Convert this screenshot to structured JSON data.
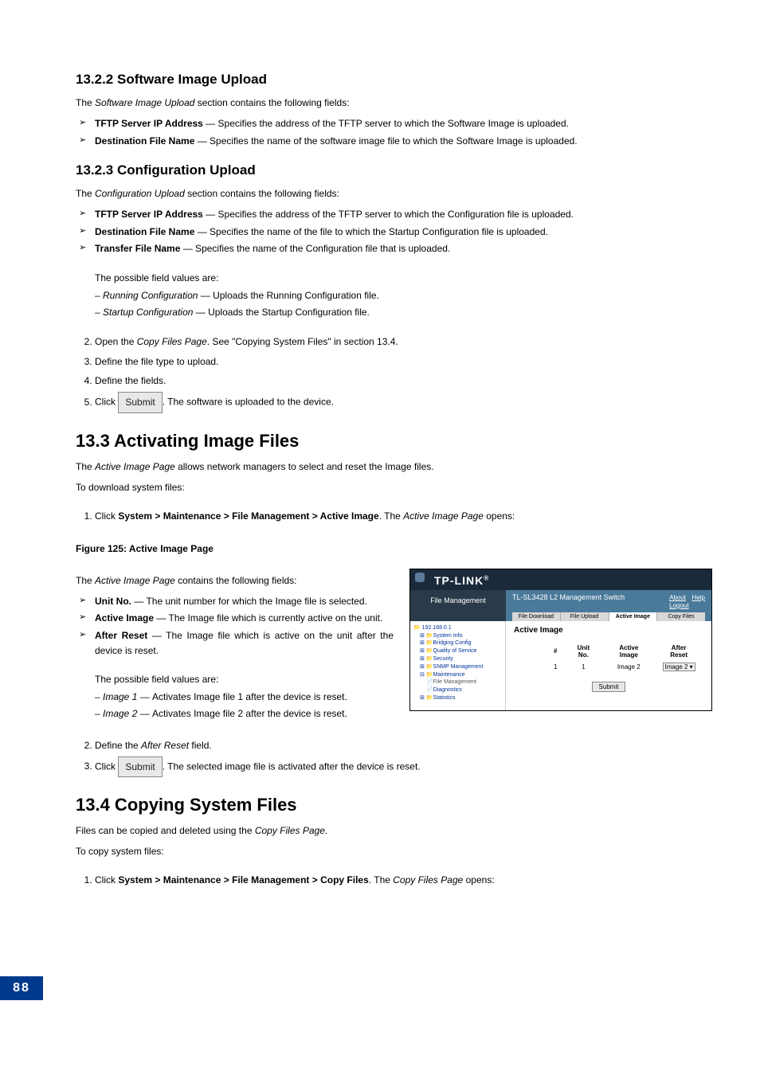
{
  "sec1": {
    "heading": "13.2.2  Software Image Upload",
    "intro_pre": "The ",
    "intro_em": "Software Image Upload",
    "intro_post": " section contains the following fields:",
    "b1_b": "TFTP Server IP Address",
    "b1_t": " — Specifies the address of the TFTP server to which the Software Image is uploaded.",
    "b2_b": "Destination File Name",
    "b2_t": " — Specifies the name of the software image file to which the Software Image is uploaded."
  },
  "sec2": {
    "heading": "13.2.3  Configuration Upload",
    "intro_pre": "The ",
    "intro_em": "Configuration Upload",
    "intro_post": " section contains the following fields:",
    "b1_b": "TFTP Server IP Address",
    "b1_t": " — Specifies the address of the TFTP server to which the Configuration file is uploaded.",
    "b2_b": "Destination File Name",
    "b2_t": " — Specifies the name of the file to which the Startup Configuration file is uploaded.",
    "b3_b": "Transfer File Name",
    "b3_t": " — Specifies the name of the Configuration file that is uploaded.",
    "sub_possible": "The possible field values are:",
    "sub_d1_em": "– Running Configuration",
    "sub_d1_t": " — Uploads the Running Configuration file.",
    "sub_d2_em": "– Startup Configuration",
    "sub_d2_t": " — Uploads the Startup Configuration file."
  },
  "steps_a": {
    "s2_pre": "Open the ",
    "s2_em": "Copy Files Page",
    "s2_post": ". See \"Copying System Files\" in section 13.4.",
    "s3": "Define the file type to upload.",
    "s4": "Define the fields.",
    "s5_pre": "Click ",
    "s5_btn": "Submit",
    "s5_post": ". The software is uploaded to the device."
  },
  "sec3": {
    "heading": "13.3  Activating Image Files",
    "p1_pre": "The ",
    "p1_em": "Active Image Page",
    "p1_post": " allows network managers to select and reset the Image files.",
    "p2": "To download system files:",
    "s1_pre": "Click ",
    "s1_b": "System > Maintenance > File Management > Active Image",
    "s1_mid": ". The ",
    "s1_em": "Active Image Page",
    "s1_post": " opens:"
  },
  "fig": "Figure 125: Active Image Page",
  "fields": {
    "intro_pre": "The ",
    "intro_em": "Active Image Page",
    "intro_post": " contains the following fields:",
    "b1_b": "Unit No.",
    "b1_t": " — The unit number for which the Image file is selected.",
    "b2_b": "Active Image",
    "b2_t": " — The Image file which is currently active on the unit.",
    "b3_b": "After Reset",
    "b3_t": " — The Image file which is active on the unit after the device is reset.",
    "sub_possible": "The possible field values are:",
    "d1_em": "– Image 1 — ",
    "d1_t": "Activates Image file 1 after the device is reset.",
    "d2_em": "– Image 2 — ",
    "d2_t": "Activates Image file 2 after the device is reset."
  },
  "steps_b": {
    "s2_pre": "Define the ",
    "s2_em": "After Reset",
    "s2_post": " field.",
    "s3_pre": "Click ",
    "s3_btn": "Submit",
    "s3_post": ". The selected image file is activated after the device is reset."
  },
  "sec4": {
    "heading": "13.4  Copying System Files",
    "p1_pre": "Files can be copied and deleted using the ",
    "p1_em": "Copy Files Page",
    "p1_post": ".",
    "p2": "To copy system files:",
    "s1_pre": "Click ",
    "s1_b": "System > Maintenance > File Management > Copy Files",
    "s1_mid": ". The ",
    "s1_em": "Copy Files Page",
    "s1_post": " opens:"
  },
  "shot": {
    "logo": "TP-LINK",
    "side_head": "File Management",
    "title": "TL-SL3428 L2 Management Switch",
    "about": "About",
    "help": "Help",
    "logout": "Logout",
    "tab1": "File Download",
    "tab2": "File Upload",
    "tab3": "Active Image",
    "tab4": "Copy Files",
    "tree": {
      "ip": "192.168.0.1",
      "t1": "System Info",
      "t2": "Bridging Config",
      "t3": "Quality of Service",
      "t4": "Security",
      "t5": "SNMP Management",
      "t6": "Maintenance",
      "t6a": "File Management",
      "t6b": "Diagnostics",
      "t7": "Statistics"
    },
    "panel_title": "Active Image",
    "th_hash": "#",
    "th_unit": "Unit No.",
    "th_active": "Active Image",
    "th_after": "After Reset",
    "td_hash": "1",
    "td_unit": "1",
    "td_active": "Image 2",
    "td_after": "Image 2",
    "submit": "Submit"
  },
  "page_num": "88"
}
